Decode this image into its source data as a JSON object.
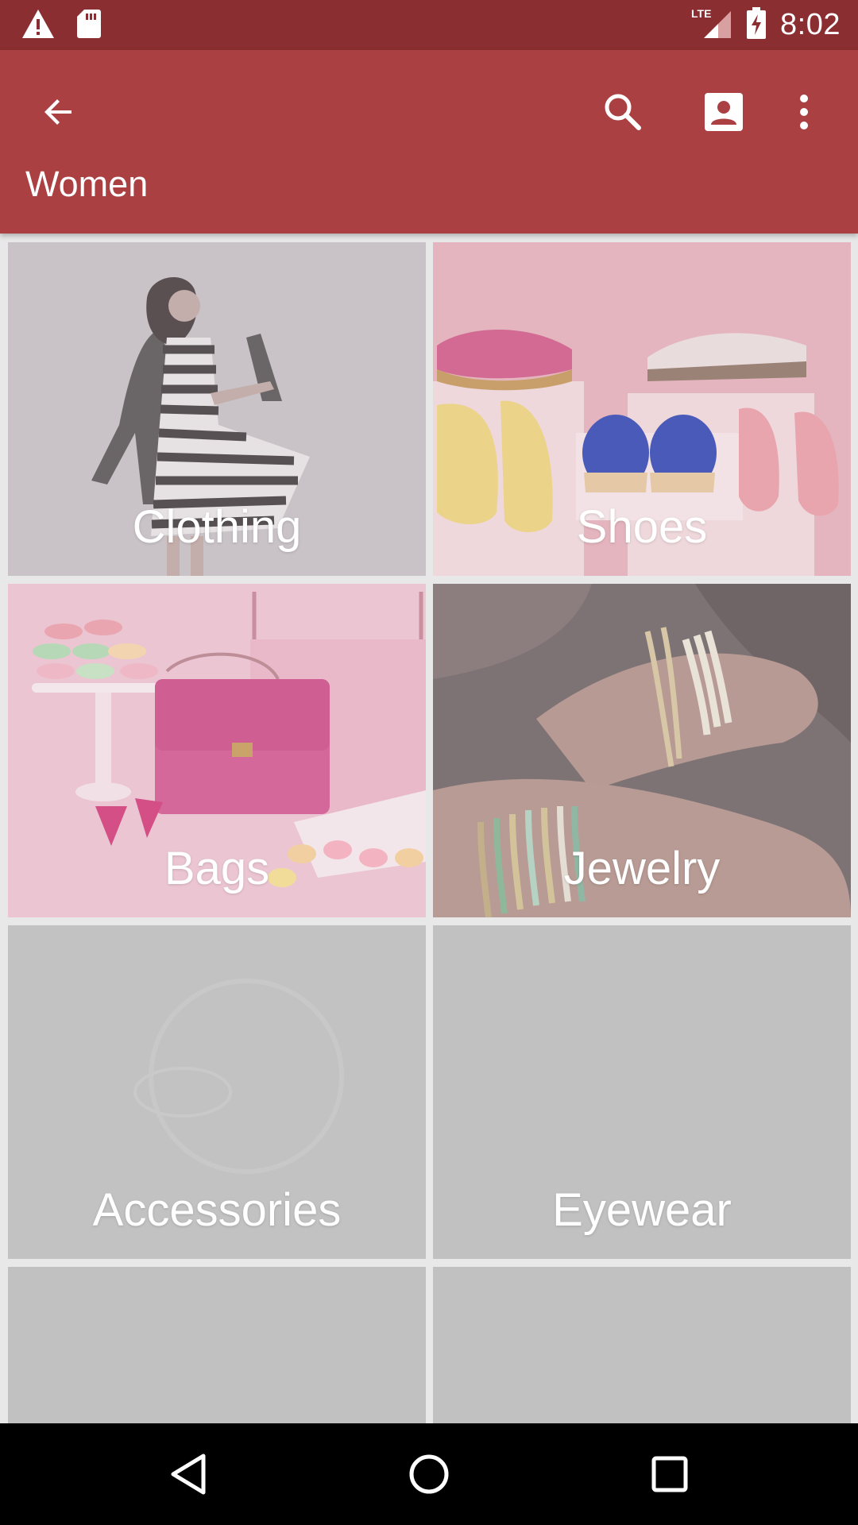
{
  "status_bar": {
    "time": "8:02",
    "network": "LTE",
    "icons": [
      "warning-icon",
      "sd-card-icon",
      "signal-icon",
      "battery-charging-icon"
    ]
  },
  "app_bar": {
    "title": "Women",
    "actions": [
      "back-arrow-icon",
      "search-icon",
      "account-icon",
      "more-vert-icon"
    ]
  },
  "categories": [
    {
      "label": "Clothing"
    },
    {
      "label": "Shoes"
    },
    {
      "label": "Bags"
    },
    {
      "label": "Jewelry"
    },
    {
      "label": "Accessories"
    },
    {
      "label": "Eyewear"
    }
  ],
  "nav_bar": {
    "buttons": [
      "nav-back-icon",
      "nav-home-icon",
      "nav-recents-icon"
    ]
  },
  "colors": {
    "status_bar": "#8a2e31",
    "app_bar": "#ab4042",
    "background": "#e8e8e8",
    "placeholder_tile": "#c0c0c0"
  }
}
